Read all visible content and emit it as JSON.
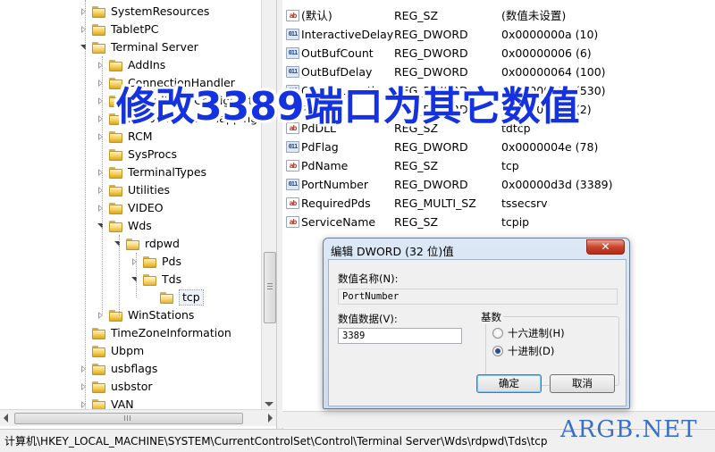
{
  "tree": {
    "items": [
      {
        "label": "SystemResources",
        "arrow": "collapsed"
      },
      {
        "label": "TabletPC",
        "arrow": "collapsed"
      },
      {
        "label": "Terminal Server",
        "arrow": "expanded"
      },
      {
        "label": "AddIns",
        "arrow": "collapsed"
      },
      {
        "label": "ConnectionHandler",
        "arrow": "collapsed"
      },
      {
        "label": "DefaultUserConfiguration",
        "arrow": "collapsed"
      },
      {
        "label": "KeyboardType Mapping",
        "arrow": "collapsed"
      },
      {
        "label": "RCM",
        "arrow": "collapsed"
      },
      {
        "label": "SysProcs",
        "arrow": "none"
      },
      {
        "label": "TerminalTypes",
        "arrow": "collapsed"
      },
      {
        "label": "Utilities",
        "arrow": "collapsed"
      },
      {
        "label": "VIDEO",
        "arrow": "collapsed"
      },
      {
        "label": "Wds",
        "arrow": "expanded"
      },
      {
        "label": "rdpwd",
        "arrow": "expanded"
      },
      {
        "label": "Pds",
        "arrow": "collapsed"
      },
      {
        "label": "Tds",
        "arrow": "expanded"
      },
      {
        "label": "tcp",
        "arrow": "none",
        "selected": true
      },
      {
        "label": "WinStations",
        "arrow": "collapsed"
      },
      {
        "label": "TimeZoneInformation",
        "arrow": "none"
      },
      {
        "label": "Ubpm",
        "arrow": "none"
      },
      {
        "label": "usbflags",
        "arrow": "collapsed"
      },
      {
        "label": "usbstor",
        "arrow": "collapsed"
      },
      {
        "label": "VAN",
        "arrow": "collapsed"
      }
    ]
  },
  "values": {
    "rows": [
      {
        "icon": "string-value-icon",
        "name": "(默认)",
        "type": "REG_SZ",
        "data": "(数值未设置)"
      },
      {
        "icon": "dword-value-icon",
        "name": "InteractiveDelay",
        "type": "REG_DWORD",
        "data": "0x0000000a (10)"
      },
      {
        "icon": "dword-value-icon",
        "name": "OutBufCount",
        "type": "REG_DWORD",
        "data": "0x00000006 (6)"
      },
      {
        "icon": "dword-value-icon",
        "name": "OutBufDelay",
        "type": "REG_DWORD",
        "data": "0x00000064 (100)"
      },
      {
        "icon": "dword-value-icon",
        "name": "OutBufLength",
        "type": "REG_DWORD",
        "data": "0x00000212 (530)"
      },
      {
        "icon": "dword-value-icon",
        "name": "PdClass",
        "type": "REG_DWORD",
        "data": "0x00000002 (2)"
      },
      {
        "icon": "string-value-icon",
        "name": "PdDLL",
        "type": "REG_SZ",
        "data": "tdtcp"
      },
      {
        "icon": "dword-value-icon",
        "name": "PdFlag",
        "type": "REG_DWORD",
        "data": "0x0000004e (78)"
      },
      {
        "icon": "string-value-icon",
        "name": "PdName",
        "type": "REG_SZ",
        "data": "tcp"
      },
      {
        "icon": "dword-value-icon",
        "name": "PortNumber",
        "type": "REG_DWORD",
        "data": "0x00000d3d (3389)"
      },
      {
        "icon": "string-value-icon",
        "name": "RequiredPds",
        "type": "REG_MULTI_SZ",
        "data": "tssecsrv"
      },
      {
        "icon": "string-value-icon",
        "name": "ServiceName",
        "type": "REG_SZ",
        "data": "tcpip"
      }
    ]
  },
  "headline": "修改3389端口为其它数值",
  "dialog": {
    "title": "编辑 DWORD (32 位)值",
    "close_label": "✕",
    "name_label": "数值名称(N):",
    "name_value": "PortNumber",
    "data_label": "数值数据(V):",
    "data_value": "3389",
    "base_label": "基数",
    "hex_label": "十六进制(H)",
    "dec_label": "十进制(D)",
    "selected_base": "decimal",
    "ok_label": "确定",
    "cancel_label": "取消"
  },
  "statusbar": {
    "path": "计算机\\HKEY_LOCAL_MACHINE\\SYSTEM\\CurrentControlSet\\Control\\Terminal Server\\Wds\\rdpwd\\Tds\\tcp"
  },
  "watermark": "ARGB.NET"
}
